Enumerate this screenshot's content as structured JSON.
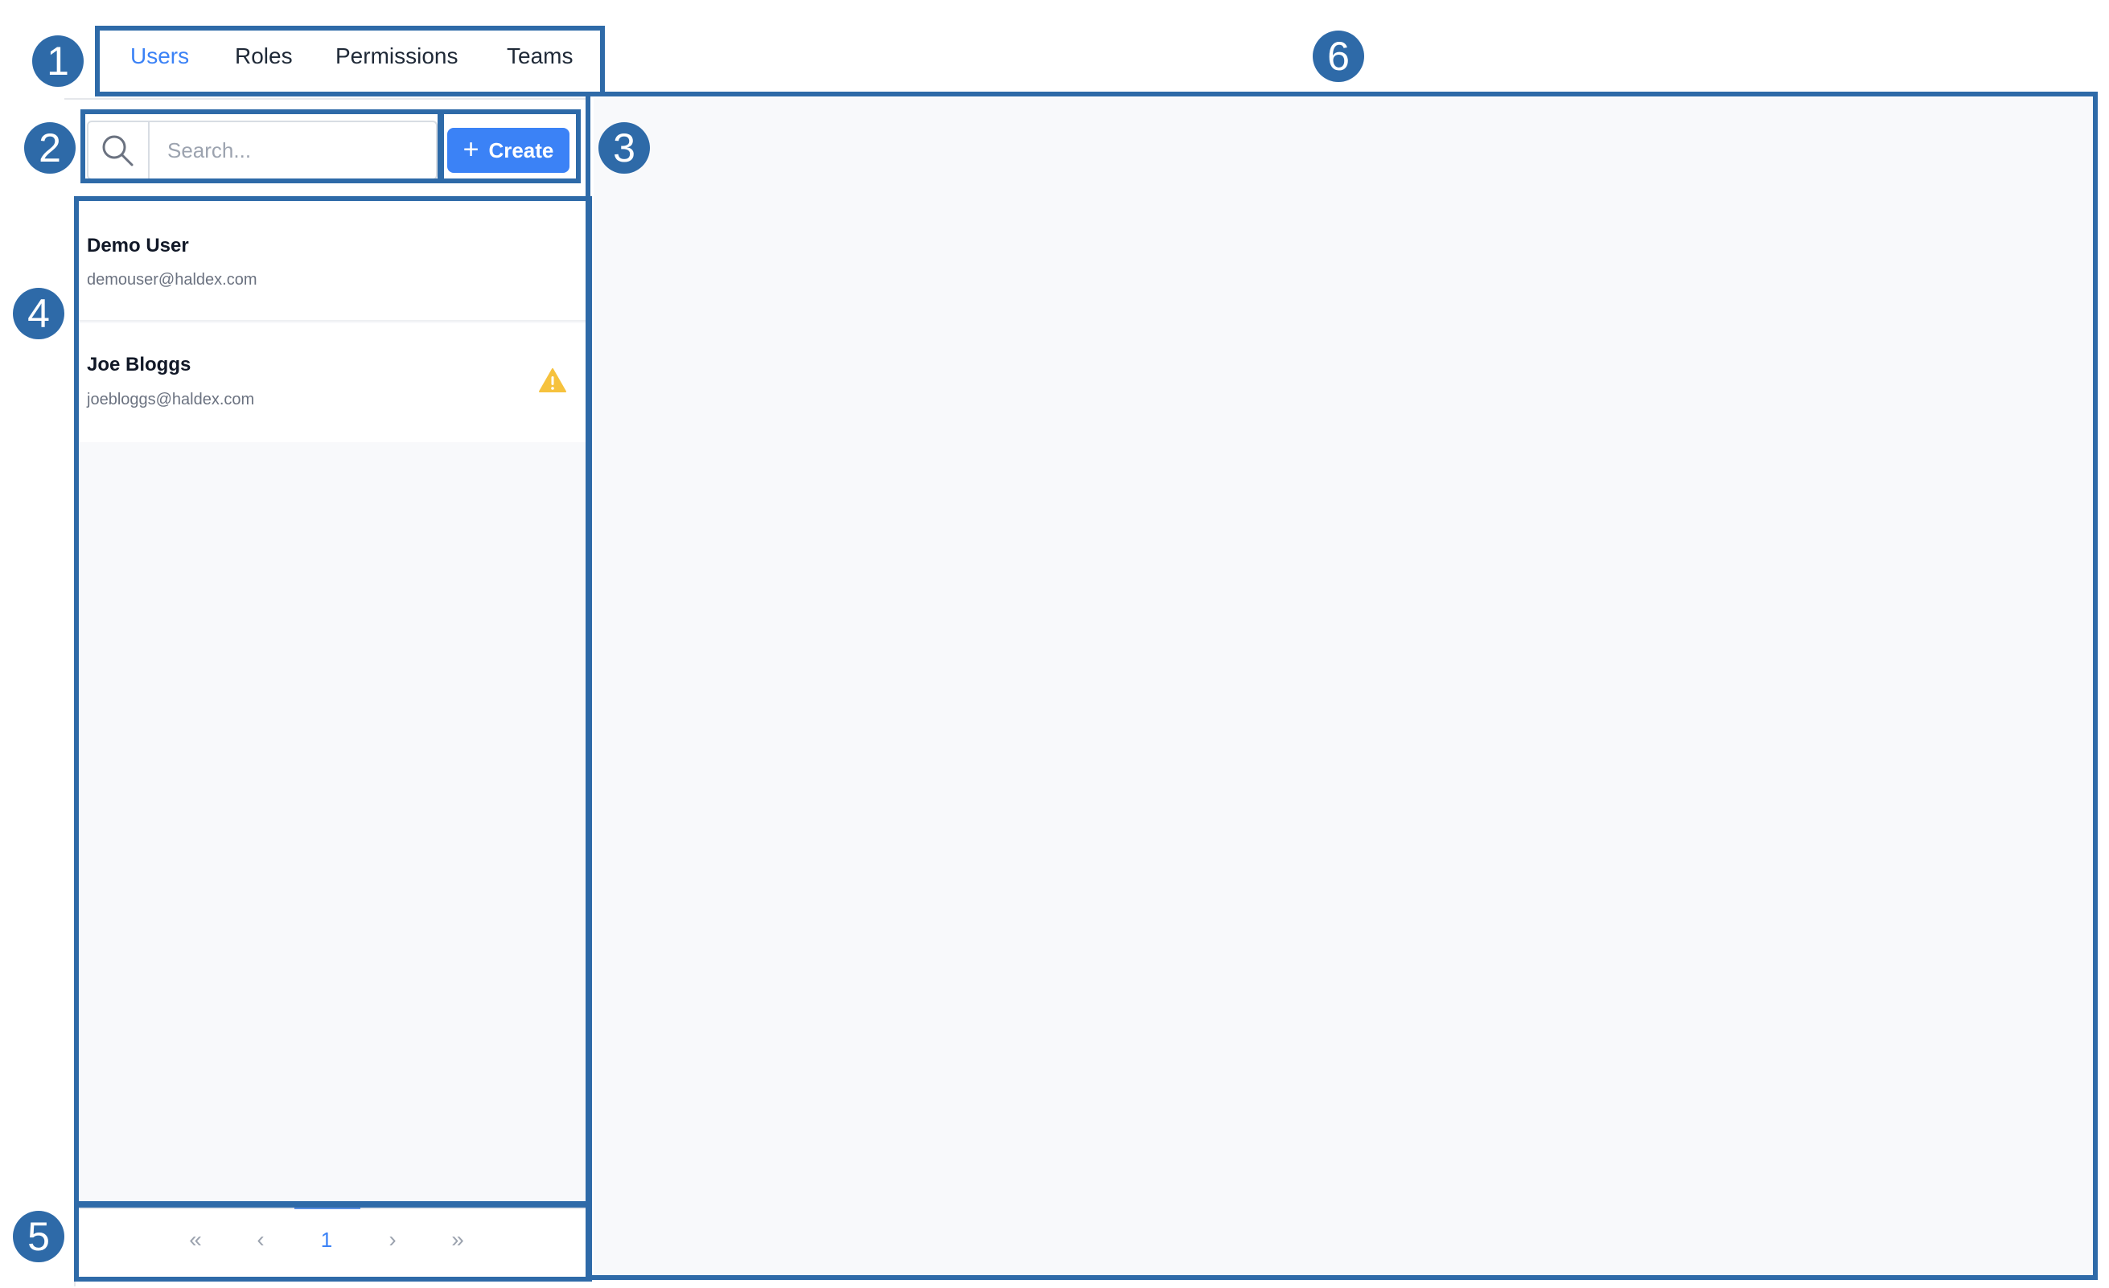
{
  "tabs": [
    {
      "label": "Users",
      "active": true
    },
    {
      "label": "Roles",
      "active": false
    },
    {
      "label": "Permissions",
      "active": false
    },
    {
      "label": "Teams",
      "active": false
    }
  ],
  "search": {
    "placeholder": "Search...",
    "value": ""
  },
  "create_button": {
    "label": "Create",
    "icon": "plus-icon"
  },
  "users": [
    {
      "name": "Demo User",
      "email": "demouser@haldex.com",
      "warning": false
    },
    {
      "name": "Joe Bloggs",
      "email": "joebloggs@haldex.com",
      "warning": true
    }
  ],
  "pagination": {
    "first": "«",
    "prev": "‹",
    "current": "1",
    "next": "›",
    "last": "»"
  },
  "annotations": [
    "1",
    "2",
    "3",
    "4",
    "5",
    "6"
  ],
  "colors": {
    "accent": "#3b82f6",
    "annotation": "#2e6aa8",
    "warning": "#f6c23e",
    "panel_bg": "#f8f9fb"
  }
}
